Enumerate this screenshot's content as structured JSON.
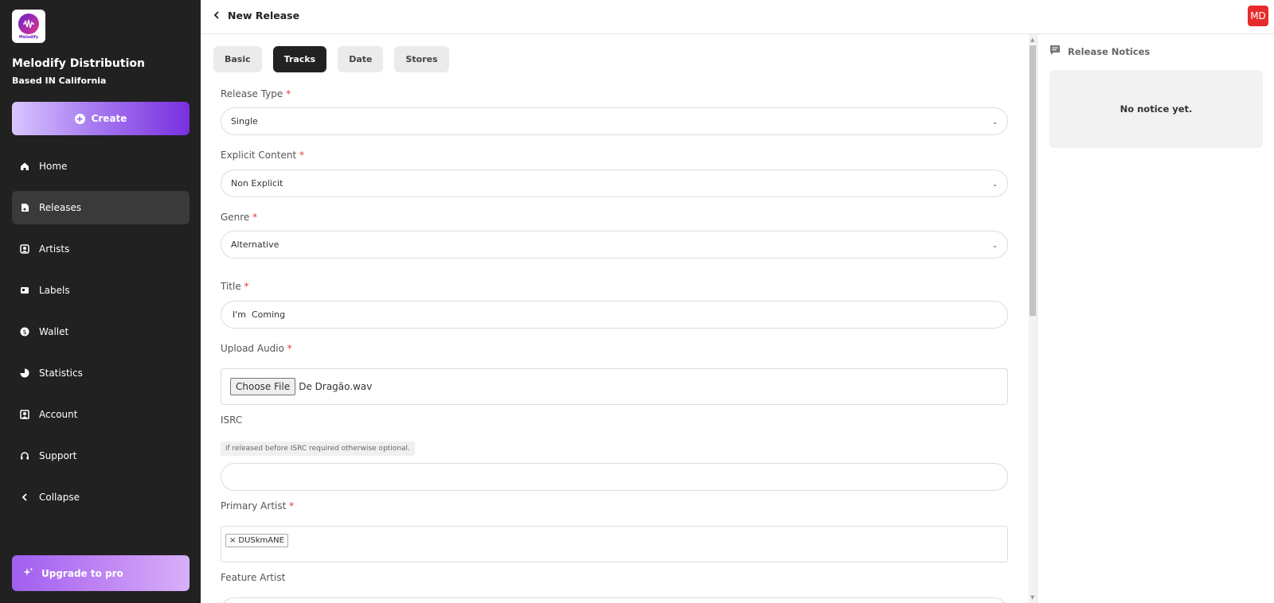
{
  "brand": {
    "name": "Melodify Distribution",
    "tagline": "Based IN California",
    "logo_text": "Melodify"
  },
  "sidebar": {
    "create_label": "Create",
    "items": [
      {
        "label": "Home",
        "icon": "home-icon"
      },
      {
        "label": "Releases",
        "icon": "releases-icon",
        "active": true
      },
      {
        "label": "Artists",
        "icon": "artists-icon"
      },
      {
        "label": "Labels",
        "icon": "labels-icon"
      },
      {
        "label": "Wallet",
        "icon": "wallet-icon"
      },
      {
        "label": "Statistics",
        "icon": "statistics-icon"
      },
      {
        "label": "Account",
        "icon": "account-icon"
      },
      {
        "label": "Support",
        "icon": "support-icon"
      },
      {
        "label": "Collapse",
        "icon": "chevron-left-icon"
      }
    ],
    "upgrade_label": "Upgrade to pro"
  },
  "header": {
    "title": "New Release",
    "avatar_initials": "MD"
  },
  "tabs": [
    {
      "label": "Basic"
    },
    {
      "label": "Tracks",
      "active": true
    },
    {
      "label": "Date"
    },
    {
      "label": "Stores"
    }
  ],
  "form": {
    "release_type": {
      "label": "Release Type",
      "value": "Single"
    },
    "explicit_content": {
      "label": "Explicit Content",
      "value": "Non Explicit"
    },
    "genre": {
      "label": "Genre",
      "value": "Alternative"
    },
    "title": {
      "label": "Title",
      "value": "I'm  Coming"
    },
    "upload_audio": {
      "label": "Upload Audio",
      "button": "Choose File",
      "file_name": "De Dragão.wav"
    },
    "isrc": {
      "label": "ISRC",
      "hint": "if released before ISRC required otherwise optional.",
      "value": ""
    },
    "primary_artist": {
      "label": "Primary Artist",
      "chips": [
        "DUSkmANE"
      ],
      "remove_glyph": "×"
    },
    "feature_artist": {
      "label": "Feature Artist"
    },
    "required_marker": "*"
  },
  "notices": {
    "title": "Release Notices",
    "empty_text": "No notice yet."
  },
  "colors": {
    "sidebar_bg": "#212121",
    "active_tab": "#222222",
    "required": "#e53935",
    "avatar": "#e52b2b",
    "accent": "#7a2fe0"
  }
}
